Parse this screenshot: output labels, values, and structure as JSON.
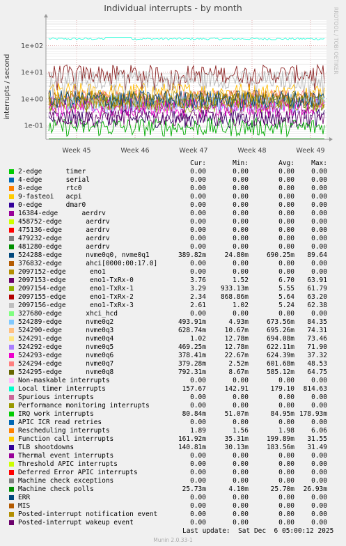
{
  "chart_data": {
    "type": "line",
    "title": "Individual interrupts - by month",
    "ylabel": "interrupts / second",
    "yscale": "log",
    "ylim": [
      0.03,
      900
    ],
    "yticks": [
      {
        "value": 0.1,
        "label": "1e-01"
      },
      {
        "value": 1,
        "label": "1e+00"
      },
      {
        "value": 10,
        "label": "1e+01"
      },
      {
        "value": 100,
        "label": "1e+02"
      }
    ],
    "xlabels": [
      "Week 45",
      "Week 46",
      "Week 47",
      "Week 48",
      "Week 49"
    ],
    "grid": true,
    "series_levels": [
      {
        "name": "Local timer interrupts",
        "color": "#33ffdd",
        "level": 179.1
      },
      {
        "name": "nvme0q0, nvme0q1",
        "color": "#8a2020",
        "level": 8.5
      },
      {
        "name": "Function call interrupts",
        "color": "#ffbb00",
        "level": 1.8
      },
      {
        "name": "eno1-TxRx-3",
        "color": "#b8b8b8",
        "level": 5.24
      },
      {
        "name": "nvme0q5",
        "color": "#b593ff",
        "level": 0.62
      },
      {
        "name": "TLB shootdowns",
        "color": "#330066",
        "level": 0.18
      },
      {
        "name": "Machine check polls",
        "color": "#009900",
        "level": 0.026
      },
      {
        "name": "IRQ work interrupts",
        "color": "#00aa00",
        "level": 0.085
      }
    ]
  },
  "side_label": "RRDTOOL / TOBI OETIKER",
  "legend": {
    "headers": {
      "cur": "Cur:",
      "min": "Min:",
      "avg": "Avg:",
      "max": "Max:"
    },
    "rows": [
      {
        "name": "2-edge      timer",
        "color": "#00cc00",
        "cur": "0.00",
        "min": "0.00",
        "avg": "0.00",
        "max": "0.00"
      },
      {
        "name": "4-edge      serial",
        "color": "#0066b3",
        "cur": "0.00",
        "min": "0.00",
        "avg": "0.00",
        "max": "0.00"
      },
      {
        "name": "8-edge      rtc0",
        "color": "#ff8000",
        "cur": "0.00",
        "min": "0.00",
        "avg": "0.00",
        "max": "0.00"
      },
      {
        "name": "9-fasteoi   acpi",
        "color": "#ffcc00",
        "cur": "0.00",
        "min": "0.00",
        "avg": "0.00",
        "max": "0.00"
      },
      {
        "name": "0-edge      dmar0",
        "color": "#330099",
        "cur": "0.00",
        "min": "0.00",
        "avg": "0.00",
        "max": "0.00"
      },
      {
        "name": "16384-edge      aerdrv",
        "color": "#990099",
        "cur": "0.00",
        "min": "0.00",
        "avg": "0.00",
        "max": "0.00"
      },
      {
        "name": "458752-edge      aerdrv",
        "color": "#ccff00",
        "cur": "0.00",
        "min": "0.00",
        "avg": "0.00",
        "max": "0.00"
      },
      {
        "name": "475136-edge      aerdrv",
        "color": "#ff0000",
        "cur": "0.00",
        "min": "0.00",
        "avg": "0.00",
        "max": "0.00"
      },
      {
        "name": "479232-edge      aerdrv",
        "color": "#808080",
        "cur": "0.00",
        "min": "0.00",
        "avg": "0.00",
        "max": "0.00"
      },
      {
        "name": "481280-edge      aerdrv",
        "color": "#008f00",
        "cur": "0.00",
        "min": "0.00",
        "avg": "0.00",
        "max": "0.00"
      },
      {
        "name": "524288-edge      nvme0q0, nvme0q1",
        "color": "#00487d",
        "cur": "389.82m",
        "min": "24.80m",
        "avg": "690.25m",
        "max": "89.64"
      },
      {
        "name": "376832-edge      ahci[0000:00:17.0]",
        "color": "#b35a00",
        "cur": "0.00",
        "min": "0.00",
        "avg": "0.00",
        "max": "0.00"
      },
      {
        "name": "2097152-edge      eno1",
        "color": "#b38f00",
        "cur": "0.00",
        "min": "0.00",
        "avg": "0.00",
        "max": "0.00"
      },
      {
        "name": "2097153-edge      eno1-TxRx-0",
        "color": "#6b006b",
        "cur": "3.76",
        "min": "1.52",
        "avg": "6.70",
        "max": "63.91"
      },
      {
        "name": "2097154-edge      eno1-TxRx-1",
        "color": "#8fb300",
        "cur": "3.29",
        "min": "933.13m",
        "avg": "5.55",
        "max": "61.79"
      },
      {
        "name": "2097155-edge      eno1-TxRx-2",
        "color": "#b30000",
        "cur": "2.34",
        "min": "868.86m",
        "avg": "5.64",
        "max": "63.20"
      },
      {
        "name": "2097156-edge      eno1-TxRx-3",
        "color": "#bebebe",
        "cur": "2.61",
        "min": "1.02",
        "avg": "5.24",
        "max": "62.38"
      },
      {
        "name": "327680-edge      xhci_hcd",
        "color": "#80ff80",
        "cur": "0.00",
        "min": "0.00",
        "avg": "0.00",
        "max": "0.00"
      },
      {
        "name": "524289-edge      nvme0q2",
        "color": "#80c9ff",
        "cur": "493.91m",
        "min": "4.93m",
        "avg": "673.56m",
        "max": "84.35"
      },
      {
        "name": "524290-edge      nvme0q3",
        "color": "#ffc080",
        "cur": "628.74m",
        "min": "10.67m",
        "avg": "695.26m",
        "max": "74.31"
      },
      {
        "name": "524291-edge      nvme0q4",
        "color": "#ffe680",
        "cur": "1.02",
        "min": "12.78m",
        "avg": "694.08m",
        "max": "73.46"
      },
      {
        "name": "524292-edge      nvme0q5",
        "color": "#aa80ff",
        "cur": "469.25m",
        "min": "12.78m",
        "avg": "622.11m",
        "max": "71.90"
      },
      {
        "name": "524293-edge      nvme0q6",
        "color": "#ee00cc",
        "cur": "378.41m",
        "min": "22.67m",
        "avg": "624.39m",
        "max": "37.32"
      },
      {
        "name": "524294-edge      nvme0q7",
        "color": "#ff8080",
        "cur": "379.28m",
        "min": "2.52m",
        "avg": "601.68m",
        "max": "48.53"
      },
      {
        "name": "524295-edge      nvme0q8",
        "color": "#666600",
        "cur": "792.31m",
        "min": "8.67m",
        "avg": "585.12m",
        "max": "64.75"
      },
      {
        "name": "Non-maskable interrupts",
        "color": "#ffbfff",
        "cur": "0.00",
        "min": "0.00",
        "avg": "0.00",
        "max": "0.00"
      },
      {
        "name": "Local timer interrupts",
        "color": "#00ffcc",
        "cur": "157.67",
        "min": "142.91",
        "avg": "179.10",
        "max": "814.63"
      },
      {
        "name": "Spurious interrupts",
        "color": "#cc6699",
        "cur": "0.00",
        "min": "0.00",
        "avg": "0.00",
        "max": "0.00"
      },
      {
        "name": "Performance monitoring interrupts",
        "color": "#999900",
        "cur": "0.00",
        "min": "0.00",
        "avg": "0.00",
        "max": "0.00"
      },
      {
        "name": "IRQ work interrupts",
        "color": "#00cc00",
        "cur": "80.84m",
        "min": "51.07m",
        "avg": "84.95m",
        "max": "178.93m"
      },
      {
        "name": "APIC ICR read retries",
        "color": "#0066b3",
        "cur": "0.00",
        "min": "0.00",
        "avg": "0.00",
        "max": "0.00"
      },
      {
        "name": "Rescheduling interrupts",
        "color": "#ff8000",
        "cur": "1.89",
        "min": "1.56",
        "avg": "1.98",
        "max": "6.06"
      },
      {
        "name": "Function call interrupts",
        "color": "#ffcc00",
        "cur": "161.92m",
        "min": "35.31m",
        "avg": "199.89m",
        "max": "31.55"
      },
      {
        "name": "TLB shootdowns",
        "color": "#330099",
        "cur": "140.81m",
        "min": "30.13m",
        "avg": "183.56m",
        "max": "31.49"
      },
      {
        "name": "Thermal event interrupts",
        "color": "#990099",
        "cur": "0.00",
        "min": "0.00",
        "avg": "0.00",
        "max": "0.00"
      },
      {
        "name": "Threshold APIC interrupts",
        "color": "#ccff00",
        "cur": "0.00",
        "min": "0.00",
        "avg": "0.00",
        "max": "0.00"
      },
      {
        "name": "Deferred Error APIC interrupts",
        "color": "#ff0000",
        "cur": "0.00",
        "min": "0.00",
        "avg": "0.00",
        "max": "0.00"
      },
      {
        "name": "Machine check exceptions",
        "color": "#808080",
        "cur": "0.00",
        "min": "0.00",
        "avg": "0.00",
        "max": "0.00"
      },
      {
        "name": "Machine check polls",
        "color": "#008f00",
        "cur": "25.73m",
        "min": "4.10m",
        "avg": "25.70m",
        "max": "26.93m"
      },
      {
        "name": "ERR",
        "color": "#00487d",
        "cur": "0.00",
        "min": "0.00",
        "avg": "0.00",
        "max": "0.00"
      },
      {
        "name": "MIS",
        "color": "#b35a00",
        "cur": "0.00",
        "min": "0.00",
        "avg": "0.00",
        "max": "0.00"
      },
      {
        "name": "Posted-interrupt notification event",
        "color": "#b38f00",
        "cur": "0.00",
        "min": "0.00",
        "avg": "0.00",
        "max": "0.00"
      },
      {
        "name": "Posted-interrupt wakeup event",
        "color": "#6b006b",
        "cur": "0.00",
        "min": "0.00",
        "avg": "0.00",
        "max": "0.00"
      }
    ]
  },
  "footer": "Last update:  Sat Dec  6 05:00:12 2025",
  "generator": "Munin 2.0.33-1"
}
